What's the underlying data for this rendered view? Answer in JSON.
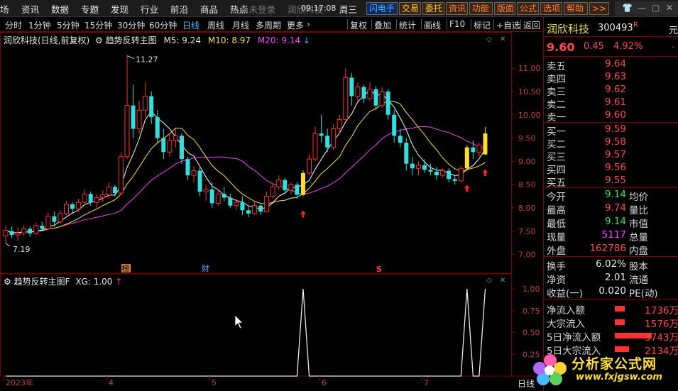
{
  "menu": {
    "items": [
      "场",
      "资讯",
      "数据",
      "专题",
      "发现",
      "行业",
      "前沿",
      "商品",
      "热点"
    ],
    "login": "尚未登录",
    "ghost": "润欣科技",
    "time": "09:17:08",
    "weekday": "周三",
    "tools": [
      {
        "label": "闪电手",
        "color": "#40b0ff"
      },
      {
        "label": "交易",
        "color": "#ffd040"
      },
      {
        "label": "委托",
        "color": "#ffd040"
      },
      {
        "label": "资讯",
        "color": "#ff8040"
      },
      {
        "label": "功能",
        "color": "#ff8040"
      },
      {
        "label": "版面",
        "color": "#ff8040"
      },
      {
        "label": "公式",
        "color": "#ff8040"
      },
      {
        "label": "选项",
        "color": "#ff8040"
      },
      {
        "label": "帮助",
        "color": "#ff8040"
      },
      {
        "label": ">>",
        "color": "#ff8040"
      }
    ]
  },
  "periods": [
    "分时",
    "1分钟",
    "5分钟",
    "15分钟",
    "30分钟",
    "60分钟",
    "日线",
    "周线",
    "月线",
    "多周期",
    "更多"
  ],
  "active_period": "日线",
  "right_tools": [
    "复权",
    "叠加",
    "统计",
    "画线",
    "F10",
    "标记",
    "+自选",
    "返回"
  ],
  "legend": {
    "stock": "润欣科技(日线,前复权)",
    "indicator": "趋势反转主图",
    "ma5": "M5: 9.24",
    "ma10": "M10: 8.97",
    "ma20": "M20: 9.14",
    "arrow": "↓"
  },
  "sub_legend": {
    "name": "趋势反转主图F",
    "xg": "XG: 1.00",
    "arrow": "↑"
  },
  "annotations": {
    "high_label": "11.27",
    "low_label": "7.19",
    "marker_bang": "榜",
    "marker_cai": "财",
    "marker_s": "S"
  },
  "x_axis": {
    "labels": [
      "2023年",
      "4",
      "5",
      "6",
      "7"
    ]
  },
  "y_axis_main": [
    "11.00",
    "10.50",
    "10.00",
    "9.50",
    "9.00",
    "8.50",
    "8.00",
    "7.50",
    "7.00"
  ],
  "y_axis_sub": [
    "1.00",
    "0.75",
    "0.50",
    "0.25"
  ],
  "watermark": "分析家公式网",
  "watermark_url": "www.fxjgsw.com",
  "quote": {
    "name": "润欣科技",
    "code": "300493",
    "code_flag": "R",
    "price": "9.60",
    "change": "0.45",
    "pct": "4.92%",
    "side_char": "元",
    "asks": [
      {
        "label": "卖五",
        "price": "9.64"
      },
      {
        "label": "卖四",
        "price": "9.63"
      },
      {
        "label": "卖三",
        "price": "9.62"
      },
      {
        "label": "卖二",
        "price": "9.61"
      },
      {
        "label": "卖一",
        "price": "9.60"
      }
    ],
    "bids": [
      {
        "label": "买一",
        "price": "9.59"
      },
      {
        "label": "买二",
        "price": "9.58"
      },
      {
        "label": "买三",
        "price": "9.57"
      },
      {
        "label": "买四",
        "price": "9.56"
      },
      {
        "label": "买五",
        "price": "9.55"
      }
    ],
    "stats": [
      {
        "label": "今开",
        "value": "9.14",
        "label2": "均价",
        "color": "#40e040"
      },
      {
        "label": "最高",
        "value": "9.74",
        "label2": "量比",
        "color": "#ff4a4a"
      },
      {
        "label": "最低",
        "value": "9.14",
        "label2": "市值",
        "color": "#40e040"
      },
      {
        "label": "现量",
        "value": "5117",
        "label2": "总量",
        "color": "#ff40ff"
      },
      {
        "label": "外盘",
        "value": "162786",
        "label2": "内盘",
        "color": "#ff4a4a"
      }
    ],
    "stats2": [
      {
        "label": "换手",
        "value": "6.02%",
        "label2": "股本"
      },
      {
        "label": "净资",
        "value": "2.01",
        "label2": "流通"
      },
      {
        "label": "收益(一)",
        "value": "0.020",
        "label2": "PE(动)"
      }
    ],
    "flows": [
      {
        "label": "净流入额",
        "value": "1736万"
      },
      {
        "label": "大宗流入",
        "value": "1576万"
      },
      {
        "label": "5日净流入额",
        "value": "3743万"
      },
      {
        "label": "5日大宗流入",
        "value": "2134万"
      }
    ],
    "bottom_char": "日线"
  },
  "chart_data": {
    "type": "candlestick",
    "ylim": [
      6.75,
      11.4
    ],
    "candles": [
      [
        7.4,
        7.62,
        7.24,
        7.52
      ],
      [
        7.5,
        7.6,
        7.35,
        7.42
      ],
      [
        7.42,
        7.58,
        7.3,
        7.46
      ],
      [
        7.46,
        7.62,
        7.4,
        7.55
      ],
      [
        7.55,
        7.6,
        7.38,
        7.45
      ],
      [
        7.45,
        7.68,
        7.42,
        7.62
      ],
      [
        7.62,
        7.7,
        7.5,
        7.55
      ],
      [
        7.55,
        7.9,
        7.52,
        7.82
      ],
      [
        7.82,
        7.92,
        7.6,
        7.7
      ],
      [
        7.7,
        7.95,
        7.65,
        7.88
      ],
      [
        7.88,
        8.15,
        7.85,
        8.08
      ],
      [
        8.08,
        8.12,
        7.9,
        7.98
      ],
      [
        7.98,
        8.2,
        7.92,
        8.12
      ],
      [
        8.12,
        8.4,
        8.05,
        8.3
      ],
      [
        8.3,
        8.35,
        8.05,
        8.12
      ],
      [
        8.12,
        8.3,
        8.0,
        8.22
      ],
      [
        8.22,
        8.38,
        8.12,
        8.28
      ],
      [
        8.28,
        8.55,
        8.2,
        8.45
      ],
      [
        8.45,
        8.5,
        8.25,
        8.32
      ],
      [
        8.32,
        9.2,
        8.3,
        9.1
      ],
      [
        9.1,
        11.27,
        9.05,
        10.2
      ],
      [
        10.2,
        10.65,
        9.5,
        9.7
      ],
      [
        9.7,
        10.3,
        9.6,
        10.1
      ],
      [
        10.1,
        10.7,
        9.95,
        10.4
      ],
      [
        10.4,
        10.5,
        9.8,
        9.95
      ],
      [
        9.95,
        10.1,
        9.4,
        9.5
      ],
      [
        9.5,
        9.7,
        9.05,
        9.2
      ],
      [
        9.2,
        9.6,
        9.1,
        9.45
      ],
      [
        9.45,
        9.7,
        9.3,
        9.55
      ],
      [
        9.55,
        9.6,
        8.95,
        9.05
      ],
      [
        9.05,
        9.1,
        8.6,
        8.7
      ],
      [
        8.7,
        8.9,
        8.55,
        8.8
      ],
      [
        8.8,
        8.9,
        8.25,
        8.35
      ],
      [
        8.35,
        8.5,
        8.15,
        8.4
      ],
      [
        8.4,
        8.55,
        8.0,
        8.1
      ],
      [
        8.1,
        8.4,
        8.05,
        8.3
      ],
      [
        8.3,
        8.45,
        8.15,
        8.22
      ],
      [
        8.22,
        8.3,
        8.0,
        8.05
      ],
      [
        8.05,
        8.2,
        7.95,
        8.12
      ],
      [
        8.12,
        8.25,
        7.85,
        7.95
      ],
      [
        7.95,
        8.05,
        7.8,
        7.88
      ],
      [
        7.88,
        8.15,
        7.85,
        8.05
      ],
      [
        8.05,
        8.1,
        7.85,
        7.92
      ],
      [
        7.92,
        8.35,
        7.9,
        8.25
      ],
      [
        8.25,
        8.55,
        8.2,
        8.45
      ],
      [
        8.45,
        8.7,
        8.4,
        8.6
      ],
      [
        8.6,
        8.65,
        8.3,
        8.38
      ],
      [
        8.38,
        8.55,
        8.3,
        8.5
      ],
      [
        8.5,
        8.55,
        8.2,
        8.28
      ],
      [
        8.28,
        8.8,
        8.25,
        8.75
      ],
      [
        8.75,
        9.15,
        8.7,
        9.05
      ],
      [
        9.05,
        9.75,
        9.0,
        9.6
      ],
      [
        9.6,
        10.0,
        9.4,
        9.55
      ],
      [
        9.55,
        9.7,
        9.2,
        9.3
      ],
      [
        9.3,
        9.8,
        9.25,
        9.7
      ],
      [
        9.7,
        10.0,
        9.6,
        9.9
      ],
      [
        9.9,
        11.0,
        9.85,
        10.8
      ],
      [
        10.8,
        10.9,
        10.2,
        10.4
      ],
      [
        10.4,
        10.7,
        10.3,
        10.6
      ],
      [
        10.6,
        10.65,
        10.25,
        10.35
      ],
      [
        10.35,
        10.7,
        10.3,
        10.55
      ],
      [
        10.55,
        10.62,
        10.1,
        10.2
      ],
      [
        10.2,
        10.6,
        10.15,
        10.5
      ],
      [
        10.5,
        10.55,
        9.9,
        10.0
      ],
      [
        10.0,
        10.1,
        9.4,
        9.55
      ],
      [
        9.55,
        9.7,
        9.3,
        9.4
      ],
      [
        9.4,
        9.5,
        8.8,
        8.95
      ],
      [
        8.95,
        9.1,
        8.7,
        8.85
      ],
      [
        8.85,
        9.0,
        8.7,
        8.92
      ],
      [
        8.92,
        9.05,
        8.75,
        8.82
      ],
      [
        8.82,
        8.95,
        8.7,
        8.78
      ],
      [
        8.78,
        8.88,
        8.6,
        8.7
      ],
      [
        8.7,
        8.85,
        8.65,
        8.8
      ],
      [
        8.8,
        8.85,
        8.55,
        8.62
      ],
      [
        8.62,
        8.7,
        8.5,
        8.58
      ],
      [
        8.58,
        8.9,
        8.55,
        8.85
      ],
      [
        8.85,
        9.35,
        8.8,
        9.3
      ],
      [
        9.3,
        9.45,
        9.05,
        9.2
      ],
      [
        9.2,
        9.4,
        9.1,
        9.35
      ],
      [
        9.15,
        9.74,
        9.14,
        9.6
      ]
    ],
    "yellow_candles": [
      49,
      76,
      79
    ],
    "signal_days": [
      49,
      76,
      79
    ],
    "xg_signals": [
      49,
      76,
      79
    ]
  }
}
